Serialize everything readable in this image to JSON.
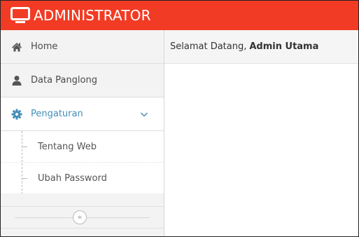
{
  "header": {
    "title": "ADMINISTRATOR",
    "icon": "monitor-icon",
    "color": "#f23b24"
  },
  "sidebar": {
    "items": [
      {
        "label": "Home",
        "icon": "home-icon"
      },
      {
        "label": "Data Panglong",
        "icon": "user-icon"
      },
      {
        "label": "Pengaturan",
        "icon": "cog-icon",
        "expanded": true,
        "color": "#438eb9"
      }
    ],
    "submenu": [
      {
        "label": "Tentang Web"
      },
      {
        "label": "Ubah Password"
      }
    ],
    "collapse_symbol": "«"
  },
  "main": {
    "welcome_prefix": "Selamat Datang,",
    "welcome_user": "Admin Utama"
  }
}
